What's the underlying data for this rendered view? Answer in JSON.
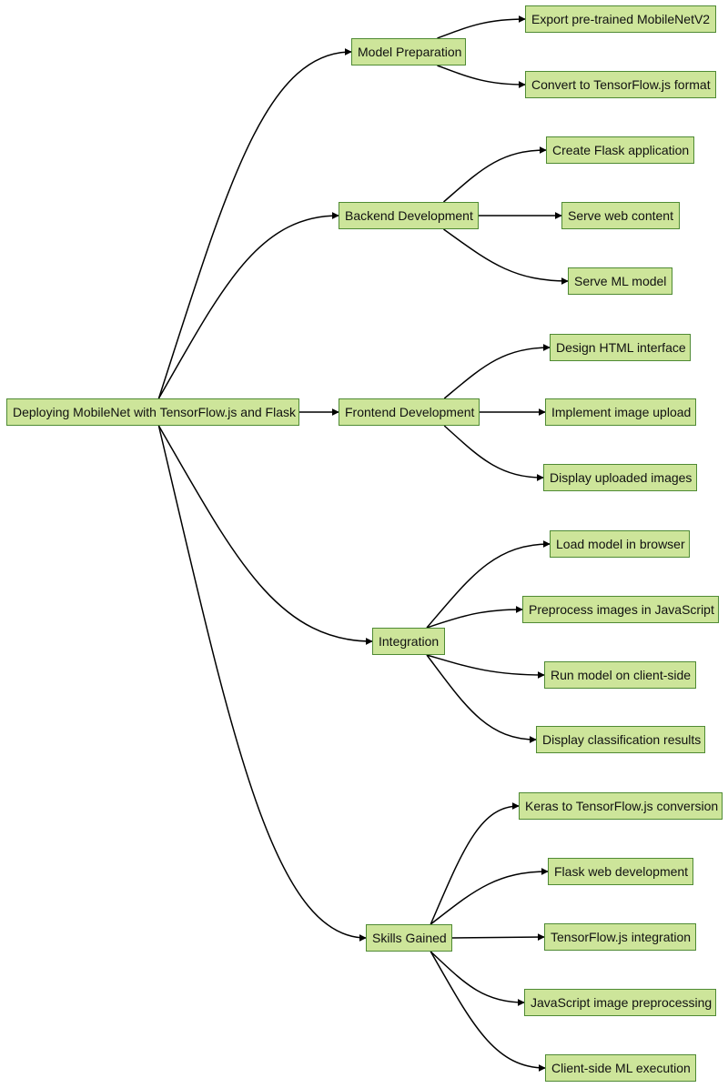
{
  "diagram": {
    "type": "mindmap-tree",
    "root": {
      "label": "Deploying MobileNet with TensorFlow.js and Flask",
      "children": [
        {
          "label": "Model Preparation",
          "children": [
            {
              "label": "Export pre-trained MobileNetV2"
            },
            {
              "label": "Convert to TensorFlow.js format"
            }
          ]
        },
        {
          "label": "Backend Development",
          "children": [
            {
              "label": "Create Flask application"
            },
            {
              "label": "Serve web content"
            },
            {
              "label": "Serve ML model"
            }
          ]
        },
        {
          "label": "Frontend Development",
          "children": [
            {
              "label": "Design HTML interface"
            },
            {
              "label": "Implement image upload"
            },
            {
              "label": "Display uploaded images"
            }
          ]
        },
        {
          "label": "Integration",
          "children": [
            {
              "label": "Load model in browser"
            },
            {
              "label": "Preprocess images in JavaScript"
            },
            {
              "label": "Run model on client-side"
            },
            {
              "label": "Display classification results"
            }
          ]
        },
        {
          "label": "Skills Gained",
          "children": [
            {
              "label": "Keras to TensorFlow.js conversion"
            },
            {
              "label": "Flask web development"
            },
            {
              "label": "TensorFlow.js integration"
            },
            {
              "label": "JavaScript image preprocessing"
            },
            {
              "label": "Client-side ML execution"
            }
          ]
        }
      ]
    },
    "colors": {
      "node_fill": "#cde59a",
      "node_border": "#4f8a34",
      "edge": "#000000",
      "text": "#111111"
    }
  }
}
